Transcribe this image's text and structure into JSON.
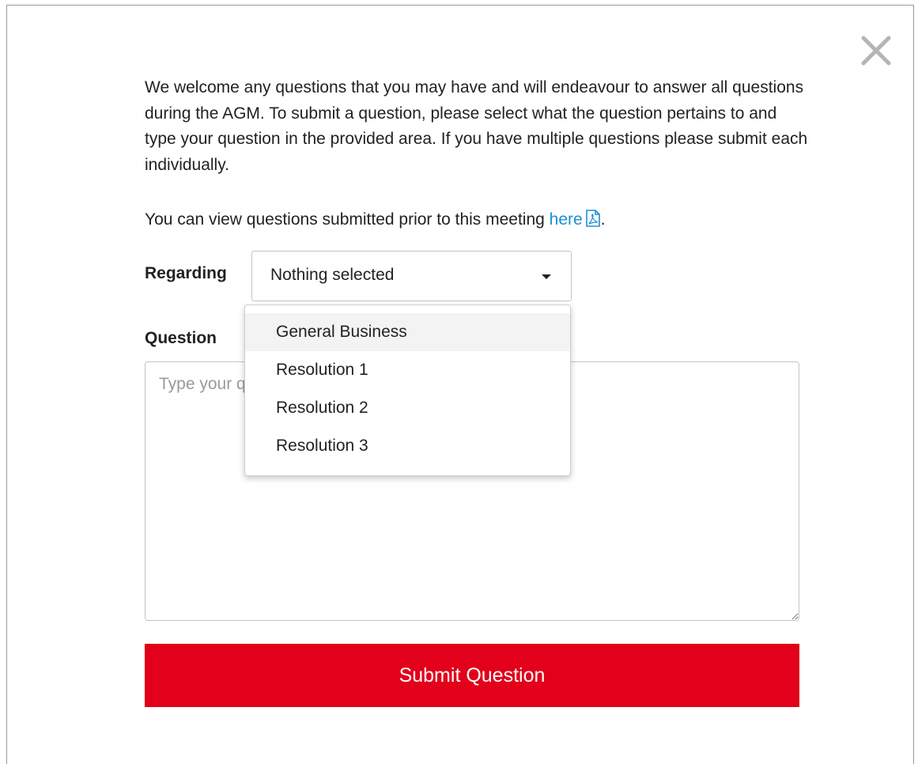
{
  "intro_text": "We welcome any questions that you may have and will endeavour to answer all questions during the AGM. To submit a question, please select what the question pertains to and type your question in the provided area. If you have multiple questions please submit each individually.",
  "prior": {
    "text": "You can view questions submitted prior to this meeting ",
    "link_label": "here",
    "suffix": "."
  },
  "regarding": {
    "label": "Regarding",
    "selected": "Nothing selected",
    "options": [
      "General Business",
      "Resolution 1",
      "Resolution 2",
      "Resolution 3"
    ],
    "highlighted_index": 0
  },
  "question": {
    "label": "Question",
    "placeholder": "Type your question here"
  },
  "submit_label": "Submit Question",
  "icons": {
    "close": "close-icon",
    "pdf": "pdf-icon",
    "caret": "caret-down-icon"
  },
  "colors": {
    "accent": "#e2001a",
    "link": "#1a8fd6",
    "text": "#222222",
    "placeholder": "#9a9a9a"
  }
}
